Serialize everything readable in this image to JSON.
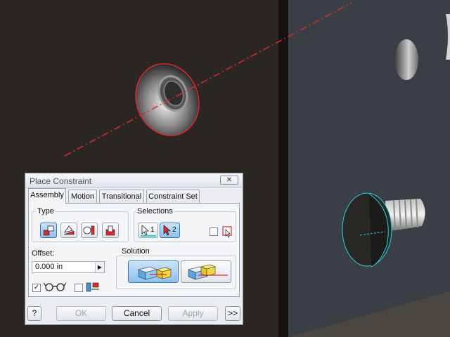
{
  "dialog": {
    "title": "Place Constraint",
    "close_label": "✕",
    "tabs": [
      {
        "label": "Assembly",
        "active": true
      },
      {
        "label": "Motion",
        "active": false
      },
      {
        "label": "Transitional",
        "active": false
      },
      {
        "label": "Constraint Set",
        "active": false
      }
    ],
    "type_label": "Type",
    "type_buttons": [
      "mate-icon",
      "angle-icon",
      "tangent-icon",
      "insert-icon"
    ],
    "selections_label": "Selections",
    "selection_1_label": "1",
    "selection_2_label": "2",
    "offset_label": "Offset:",
    "offset_value": "0.000 in",
    "solution_label": "Solution",
    "show_preview_checked": true,
    "predict_offset_checked": false,
    "first_part_checked": false,
    "buttons": {
      "help": "?",
      "ok": "OK",
      "cancel": "Cancel",
      "apply": "Apply",
      "more": ">>"
    }
  },
  "colors": {
    "background": "#2b2824",
    "part_face": "#3a3e45",
    "highlight_red": "#e0262b",
    "highlight_cyan": "#21d3e0",
    "button_active": "#8fc2ee"
  }
}
